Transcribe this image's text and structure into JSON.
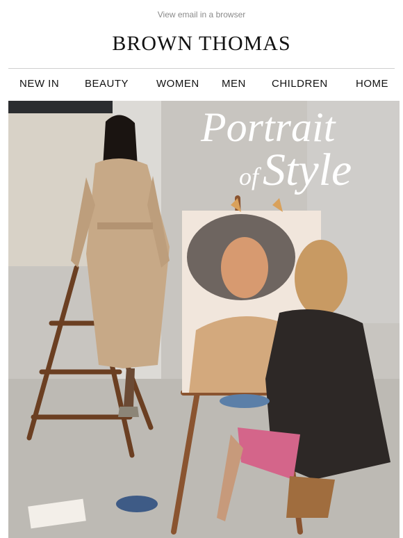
{
  "preheader": {
    "link_label": "View email in a browser"
  },
  "brand": {
    "name": "BROWN THOMAS"
  },
  "nav": {
    "items": [
      {
        "label": "NEW IN"
      },
      {
        "label": "BEAUTY"
      },
      {
        "label": "WOMEN"
      },
      {
        "label": "MEN"
      },
      {
        "label": "CHILDREN"
      },
      {
        "label": "HOME"
      }
    ]
  },
  "hero": {
    "headline_line1": "Portrait",
    "headline_of": "of",
    "headline_line2": "Style"
  },
  "colors": {
    "text": "#111111",
    "muted": "#8a8a8a",
    "divider": "#cfcfcf",
    "headline": "#ffffff"
  }
}
